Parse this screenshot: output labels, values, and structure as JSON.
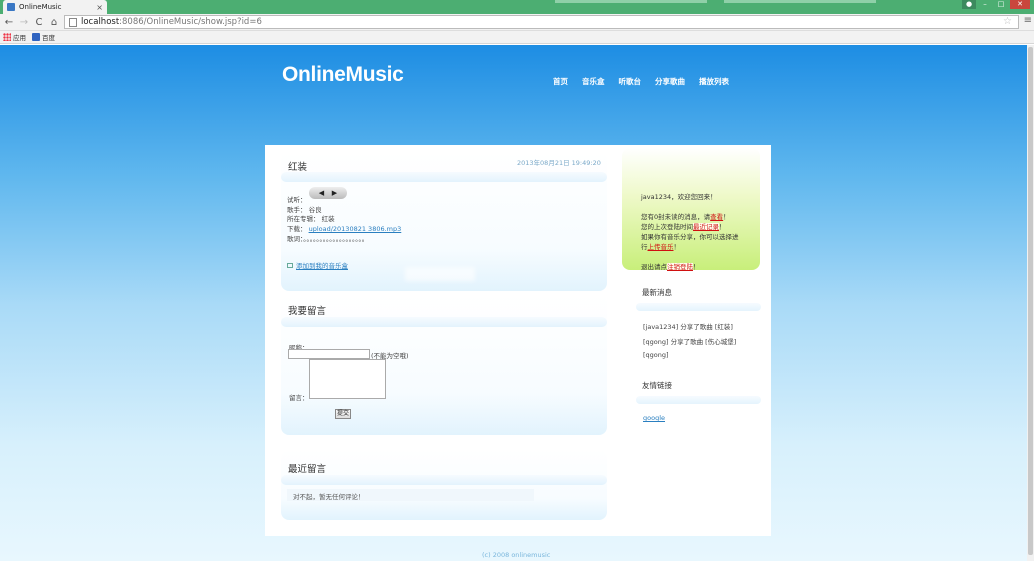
{
  "browser": {
    "tab_title": "OnlineMusic",
    "tab_close": "×",
    "url_host": "localhost",
    "url_rest": ":8086/OnlineMusic/show.jsp?id=6",
    "back": "←",
    "forward": "→",
    "reload": "C",
    "home": "⌂",
    "star": "☆",
    "menu": "≡",
    "bookmarks": [
      {
        "label": "应用"
      },
      {
        "label": "百度"
      }
    ]
  },
  "site": {
    "logo": "OnlineMusic",
    "nav": [
      "首页",
      "音乐盒",
      "听歌台",
      "分享歌曲",
      "播放列表"
    ],
    "footer": "(c) 2008 onlinemusic"
  },
  "song": {
    "title": "红装",
    "date": "2013年08月21日 19:49:20",
    "prev_btn": "◀",
    "next_btn": "▶",
    "audition_label": "试听：",
    "singer_label": "歌手：",
    "singer": "谷良",
    "album_label": "所在专辑：",
    "album": "红装",
    "download_label": "下载：",
    "download_link": "upload/20130821 3806.mp3",
    "lyrics_label": "歌词：",
    "lyrics": "。。。。。。。。。。。。。。。。。。。",
    "add_playlist": "添加到我的音乐盒"
  },
  "comment_form": {
    "title": "我要留言",
    "nick_label": "昵称：",
    "nick_hint": "(不能为空哦)",
    "message_label": "留言：",
    "submit": "提交"
  },
  "latest": {
    "title": "最近留言",
    "empty_text": "对不起，暂无任何评论！"
  },
  "sidebar": {
    "welcome_line": "java1234，欢迎您回来！",
    "line2_pre": "您有0封未读的消息，请",
    "line2_link": "查看",
    "line2_post": "！",
    "line3_pre": "您的上次登陆时间",
    "line3_link": "最近记录",
    "line3_post": "！",
    "line4": "如果你有音乐分享，你可以选择进",
    "line5_pre": "行",
    "line5_link": "上传音乐",
    "line5_post": "！",
    "line6_pre": "退出请点",
    "line6_link": "注销登陆",
    "line6_post": "！",
    "news_title": "最新消息",
    "news": [
      "[java1234] 分享了歌曲 [红装]",
      "[qgong] 分享了歌曲 [伤心城堡]",
      "[qgong]"
    ],
    "links_title": "友情链接",
    "links": [
      "google"
    ]
  }
}
